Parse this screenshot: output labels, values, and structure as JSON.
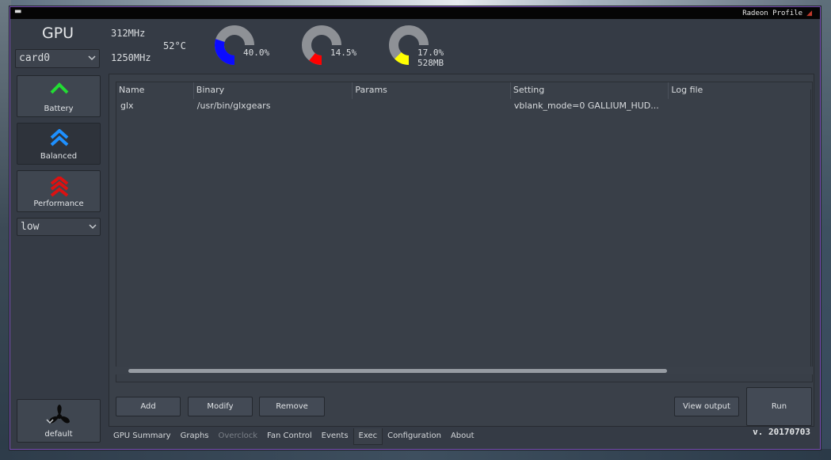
{
  "window": {
    "title": "Radeon Profile",
    "version": "v. 20170703"
  },
  "gpu": {
    "label": "GPU",
    "card_select": "card0",
    "core_clock": "312MHz",
    "mem_clock": "1250MHz",
    "temperature": "52°C"
  },
  "gauges": [
    {
      "name": "gpu-load",
      "percent_text": "40.0%",
      "value": 0.4,
      "color": "#0b0bff"
    },
    {
      "name": "mem-clock",
      "percent_text": "14.5%",
      "value": 0.145,
      "color": "#ff0000"
    },
    {
      "name": "vram",
      "percent_text": "17.0%",
      "sub_text": "528MB",
      "value": 0.17,
      "color": "#ffff00"
    }
  ],
  "profiles": {
    "battery": {
      "label": "Battery",
      "color": "#22dd33"
    },
    "balanced": {
      "label": "Balanced",
      "color": "#1e90ff"
    },
    "performance": {
      "label": "Performance",
      "color": "#dd1111"
    },
    "power_level": "low",
    "fan_profile": "default"
  },
  "table": {
    "headers": [
      "Name",
      "Binary",
      "Params",
      "Setting",
      "Log file"
    ],
    "rows": [
      [
        "glx",
        "/usr/bin/glxgears",
        "",
        "vblank_mode=0 GALLIUM_HUD...",
        ""
      ]
    ]
  },
  "buttons": {
    "add": "Add",
    "modify": "Modify",
    "remove": "Remove",
    "view_output": "View output",
    "run": "Run"
  },
  "tabs": [
    {
      "label": "GPU Summary",
      "state": "normal"
    },
    {
      "label": "Graphs",
      "state": "normal"
    },
    {
      "label": "Overclock",
      "state": "disabled"
    },
    {
      "label": "Fan Control",
      "state": "normal"
    },
    {
      "label": "Events",
      "state": "normal"
    },
    {
      "label": "Exec",
      "state": "active"
    },
    {
      "label": "Configuration",
      "state": "normal"
    },
    {
      "label": "About",
      "state": "normal"
    }
  ]
}
